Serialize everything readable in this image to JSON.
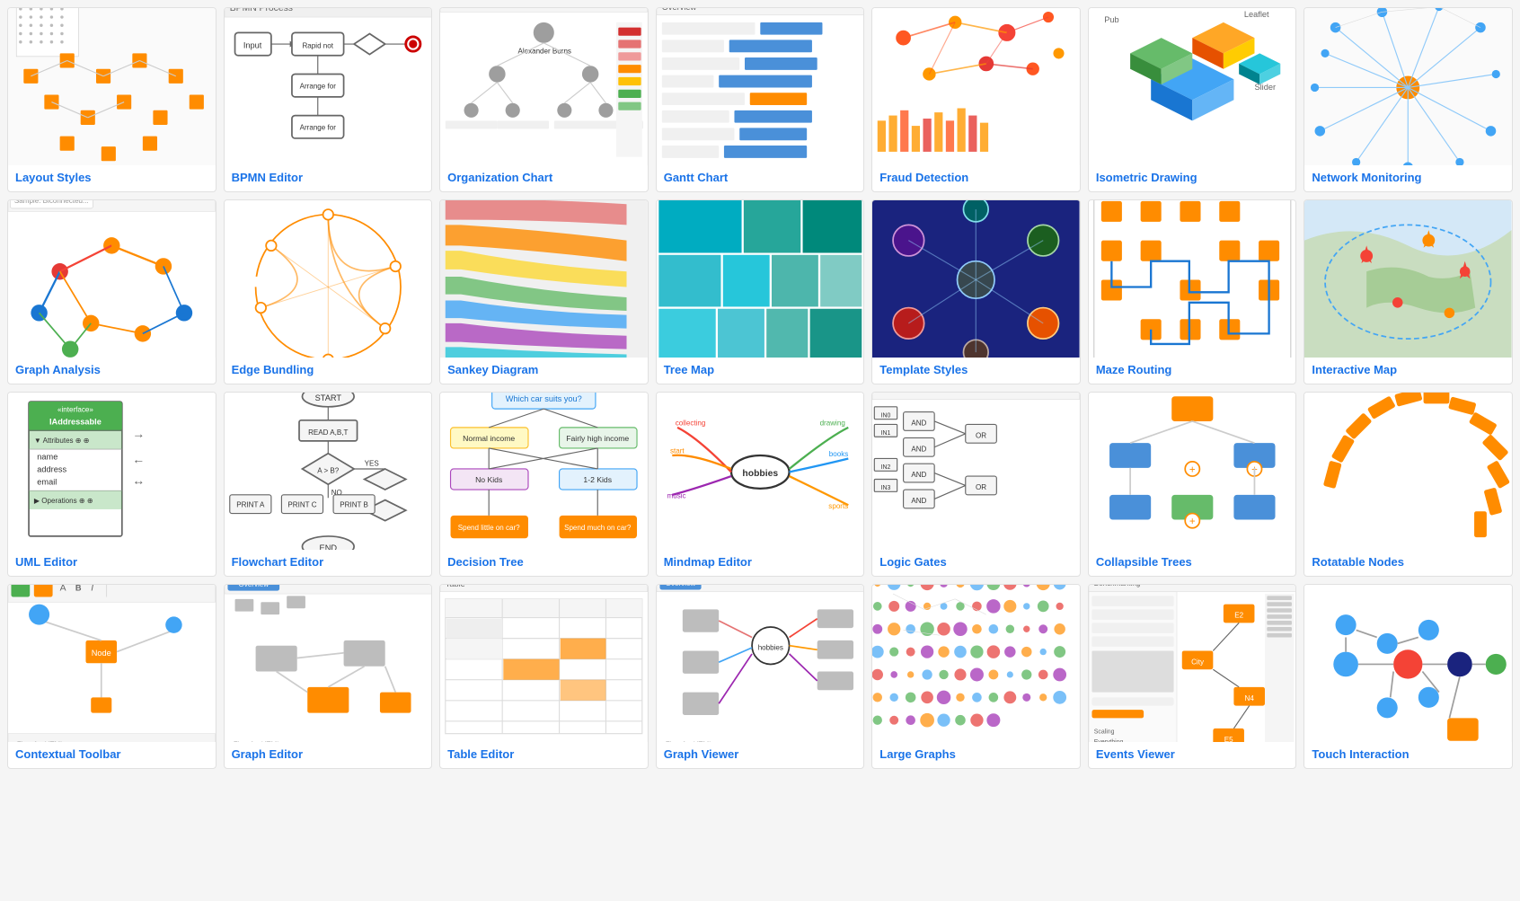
{
  "grid": {
    "items": [
      {
        "id": "layout-styles",
        "label": "Layout Styles",
        "previewType": "layout-styles",
        "bgColor": "#fff"
      },
      {
        "id": "bpmn-editor",
        "label": "BPMN Editor",
        "previewType": "bpmn",
        "bgColor": "#fff"
      },
      {
        "id": "org-chart",
        "label": "Organization Chart",
        "previewType": "org-chart",
        "bgColor": "#fff"
      },
      {
        "id": "gantt-chart",
        "label": "Gantt Chart",
        "previewType": "gantt",
        "bgColor": "#fff"
      },
      {
        "id": "fraud-detection",
        "label": "Fraud Detection",
        "previewType": "fraud",
        "bgColor": "#fff"
      },
      {
        "id": "isometric-drawing",
        "label": "Isometric Drawing",
        "previewType": "isometric",
        "bgColor": "#fff"
      },
      {
        "id": "network-monitoring",
        "label": "Network Monitoring",
        "previewType": "network",
        "bgColor": "#fff"
      },
      {
        "id": "graph-analysis",
        "label": "Graph Analysis",
        "previewType": "graph-analysis",
        "bgColor": "#fff"
      },
      {
        "id": "edge-bundling",
        "label": "Edge Bundling",
        "previewType": "edge-bundling",
        "bgColor": "#fff"
      },
      {
        "id": "sankey-diagram",
        "label": "Sankey Diagram",
        "previewType": "sankey",
        "bgColor": "#fff"
      },
      {
        "id": "tree-map",
        "label": "Tree Map",
        "previewType": "treemap",
        "bgColor": "#fff"
      },
      {
        "id": "template-styles",
        "label": "Template Styles",
        "previewType": "template-styles",
        "bgColor": "#fff"
      },
      {
        "id": "maze-routing",
        "label": "Maze Routing",
        "previewType": "maze",
        "bgColor": "#fff"
      },
      {
        "id": "interactive-map",
        "label": "Interactive Map",
        "previewType": "imap",
        "bgColor": "#fff"
      },
      {
        "id": "uml-editor",
        "label": "UML Editor",
        "previewType": "uml",
        "bgColor": "#fff"
      },
      {
        "id": "flowchart-editor",
        "label": "Flowchart Editor",
        "previewType": "flowchart",
        "bgColor": "#fff"
      },
      {
        "id": "decision-tree",
        "label": "Decision Tree",
        "previewType": "decision",
        "bgColor": "#fff"
      },
      {
        "id": "mindmap-editor",
        "label": "Mindmap Editor",
        "previewType": "mindmap",
        "bgColor": "#fff"
      },
      {
        "id": "logic-gates",
        "label": "Logic Gates",
        "previewType": "logic",
        "bgColor": "#fff"
      },
      {
        "id": "collapsible-trees",
        "label": "Collapsible Trees",
        "previewType": "collapsible",
        "bgColor": "#fff"
      },
      {
        "id": "rotatable-nodes",
        "label": "Rotatable Nodes",
        "previewType": "rotatable",
        "bgColor": "#fff"
      },
      {
        "id": "contextual-toolbar",
        "label": "Contextual Toolbar",
        "previewType": "contextual",
        "bgColor": "#fff"
      },
      {
        "id": "graph-editor",
        "label": "Graph Editor",
        "previewType": "graph-editor",
        "bgColor": "#fff"
      },
      {
        "id": "table-editor",
        "label": "Table Editor",
        "previewType": "table-editor",
        "bgColor": "#fff"
      },
      {
        "id": "graph-viewer",
        "label": "Graph Viewer",
        "previewType": "graph-viewer",
        "bgColor": "#fff"
      },
      {
        "id": "large-graphs",
        "label": "Large Graphs",
        "previewType": "large-graphs",
        "bgColor": "#fff"
      },
      {
        "id": "events-viewer",
        "label": "Events Viewer",
        "previewType": "events",
        "bgColor": "#fff"
      },
      {
        "id": "touch-interaction",
        "label": "Touch Interaction",
        "previewType": "touch",
        "bgColor": "#fff"
      }
    ]
  }
}
